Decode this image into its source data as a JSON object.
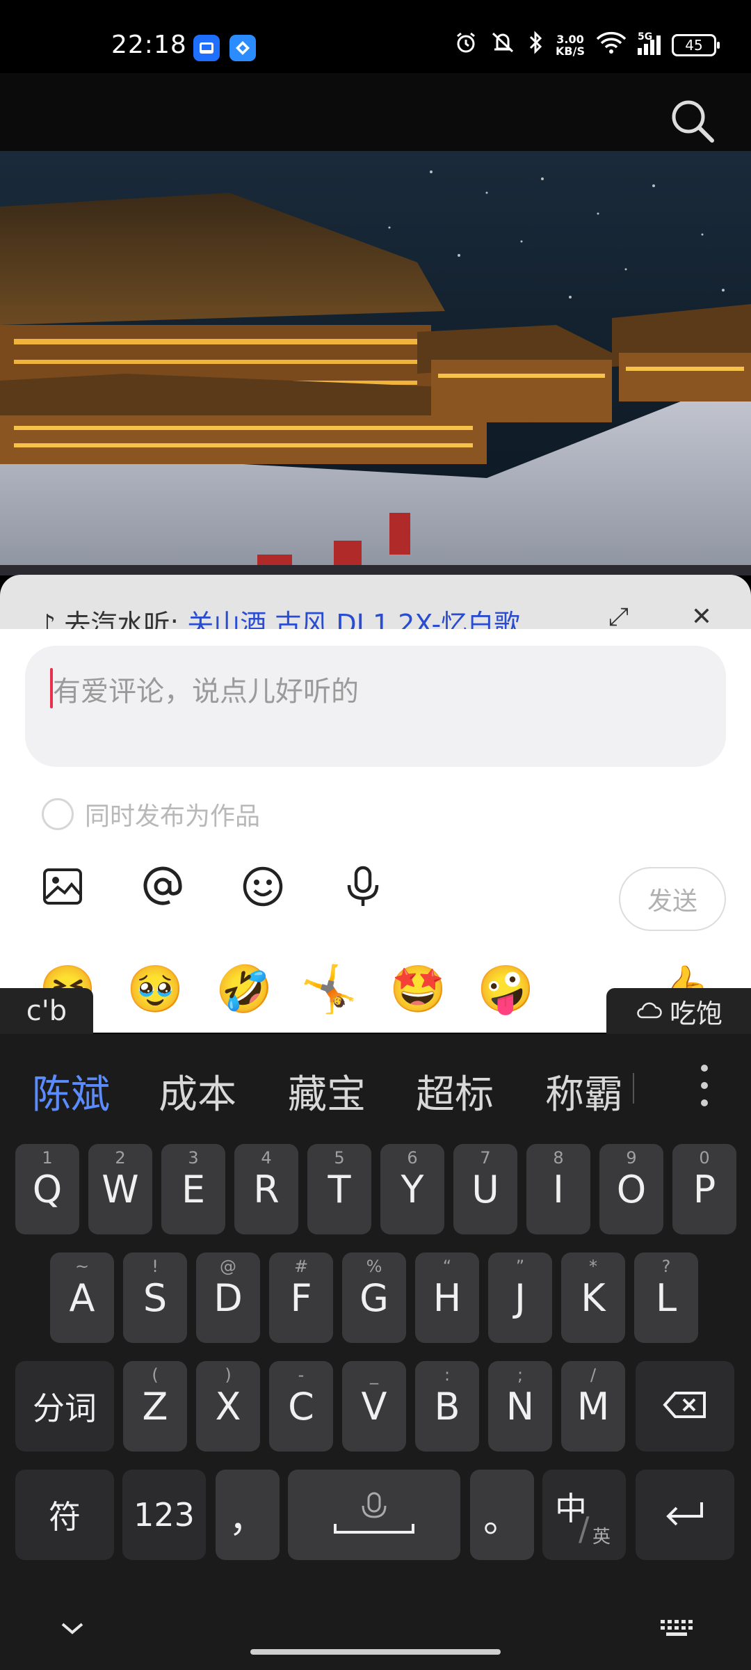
{
  "status_bar": {
    "time": "22:18",
    "net_speed_value": "3.00",
    "net_speed_unit": "KB/S",
    "signal_label": "5G",
    "battery": "45"
  },
  "video": {
    "description_icon": "palace-night-scene"
  },
  "music_bar": {
    "prefix": "去汽水听: ",
    "song": "关山酒 古风 DJ 1.2X-忆白歌"
  },
  "comment": {
    "placeholder": "有爱评论，说点儿好听的",
    "publish_as_work": "同时发布为作品",
    "send_label": "发送"
  },
  "emojis": [
    "🤧",
    "🥹",
    "🤣",
    "🤸",
    "🤩",
    "🤪",
    "😭",
    "👍"
  ],
  "ime": {
    "composing": "c'b",
    "cloud_label": "吃饱",
    "candidates": [
      "陈斌",
      "成本",
      "藏宝",
      "超标",
      "称霸"
    ],
    "row1": [
      {
        "k": "Q",
        "s": "1"
      },
      {
        "k": "W",
        "s": "2"
      },
      {
        "k": "E",
        "s": "3"
      },
      {
        "k": "R",
        "s": "4"
      },
      {
        "k": "T",
        "s": "5"
      },
      {
        "k": "Y",
        "s": "6"
      },
      {
        "k": "U",
        "s": "7"
      },
      {
        "k": "I",
        "s": "8"
      },
      {
        "k": "O",
        "s": "9"
      },
      {
        "k": "P",
        "s": "0"
      }
    ],
    "row2": [
      {
        "k": "A",
        "s": "~"
      },
      {
        "k": "S",
        "s": "!"
      },
      {
        "k": "D",
        "s": "@"
      },
      {
        "k": "F",
        "s": "#"
      },
      {
        "k": "G",
        "s": "%"
      },
      {
        "k": "H",
        "s": "“"
      },
      {
        "k": "J",
        "s": "”"
      },
      {
        "k": "K",
        "s": "*"
      },
      {
        "k": "L",
        "s": "?"
      }
    ],
    "row3": [
      {
        "k": "Z",
        "s": "("
      },
      {
        "k": "X",
        "s": ")"
      },
      {
        "k": "C",
        "s": "-"
      },
      {
        "k": "V",
        "s": "_"
      },
      {
        "k": "B",
        "s": ":"
      },
      {
        "k": "N",
        "s": ";"
      },
      {
        "k": "M",
        "s": "/"
      }
    ],
    "segment_key": "分词",
    "symbol_key": "符",
    "num_key": "123",
    "comma_key": "，",
    "period_key": "。",
    "lang_key_main": "中",
    "lang_key_sub": "英"
  }
}
